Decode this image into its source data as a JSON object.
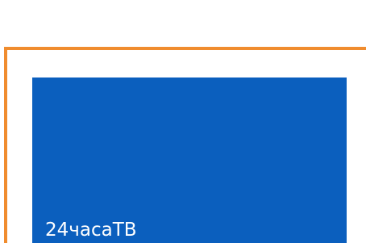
{
  "channel_tile": {
    "label": "24часаТВ",
    "background_color": "#0b5fbe",
    "focus_border_color": "#f08c2e"
  }
}
